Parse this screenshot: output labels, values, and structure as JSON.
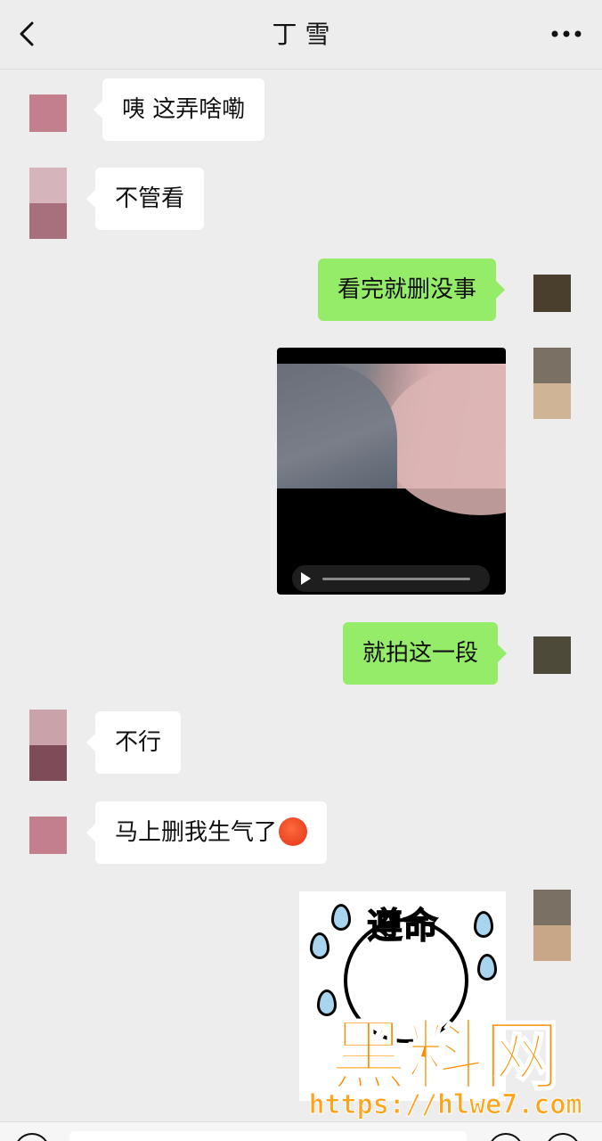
{
  "header": {
    "title": "丁  雪",
    "back_icon": "chevron-left-icon",
    "more_icon": "more-dots-icon"
  },
  "messages": [
    {
      "side": "in",
      "type": "text",
      "text": "咦 这弄啥嘞"
    },
    {
      "side": "in",
      "type": "text",
      "text": "不管看"
    },
    {
      "side": "out",
      "type": "text",
      "text": "看完就删没事"
    },
    {
      "side": "out",
      "type": "video"
    },
    {
      "side": "out",
      "type": "text",
      "text": "就拍这一段"
    },
    {
      "side": "in",
      "type": "text",
      "text": "不行"
    },
    {
      "side": "in",
      "type": "text",
      "text": "马上删我生气了",
      "emoji": "angry-face-icon"
    },
    {
      "side": "out",
      "type": "sticker",
      "text": "遵命"
    }
  ],
  "watermark": {
    "brand": "黑料网",
    "url": "https://hlwe7.com",
    "color": "#ff8c00"
  },
  "colors": {
    "background": "#ededed",
    "incoming_bubble": "#ffffff",
    "outgoing_bubble": "#95ec69"
  }
}
